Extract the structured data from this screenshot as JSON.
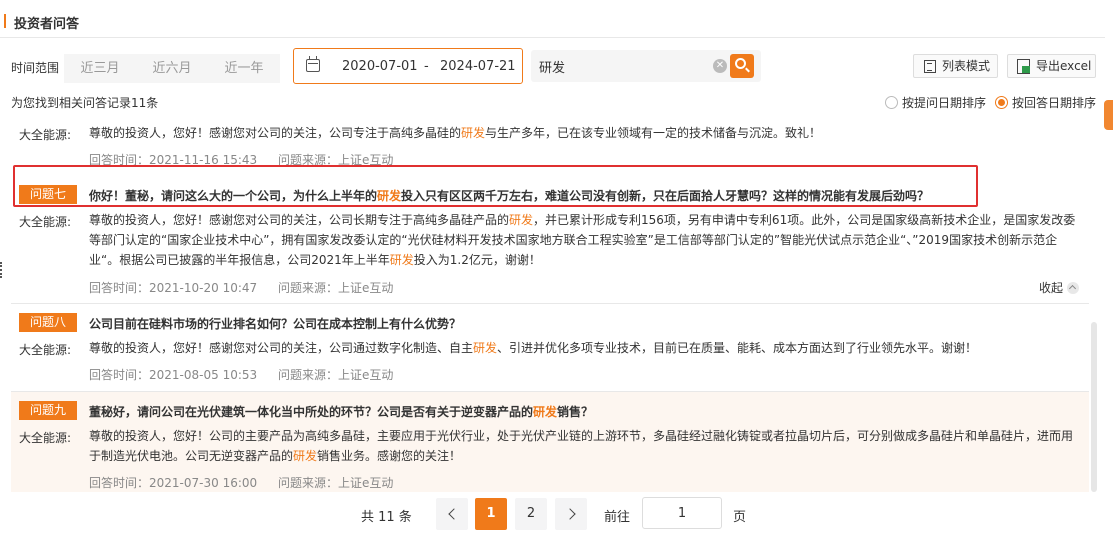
{
  "header": {
    "title": "投资者问答"
  },
  "filter": {
    "range_label": "时间范围",
    "range_options": [
      "近三月",
      "近六月",
      "近一年"
    ],
    "date_start": "2020-07-01",
    "date_sep": "-",
    "date_end": "2024-07-21",
    "search_value": "研发",
    "list_mode_label": "列表模式",
    "export_label": "导出excel"
  },
  "results": {
    "found_text": "为您找到相关问答记录11条",
    "sort_by_ask_date": "按提问日期排序",
    "sort_by_answer_date": "按回答日期排序",
    "selected_sort": "按回答日期排序"
  },
  "answer_label": "大全能源:",
  "answer_time_prefix": "回答时间：",
  "source_prefix": "问题来源：",
  "items": [
    {
      "answer_parts": [
        "尊敬的投资人，您好！感谢您对公司的关注，公司专注于高纯多晶硅的",
        "研发",
        "与生产多年，已在该专业领域有一定的技术储备与沉淀。致礼！"
      ],
      "answer_time": "2021-11-16 15:43",
      "source": "上证e互动"
    },
    {
      "tag": "问题七",
      "question_parts": [
        "你好！董秘，请问这么大的一个公司，为什么上半年的",
        "研发",
        "投入只有区区两千万左右，难道公司没有创新，只在后面拾人牙慧吗？这样的情况能有发展后劲吗？"
      ],
      "answer_parts": [
        "尊敬的投资人，您好！感谢您对公司的关注，公司长期专注于高纯多晶硅产品的",
        "研发",
        "，并已累计形成专利156项，另有申请中专利61项。此外，公司是国家级高新技术企业，是国家发改委等部门认定的“国家企业技术中心”，拥有国家发改委认定的“光伏硅材料开发技术国家地方联合工程实验室”是工信部等部门认定的”智能光伏试点示范企业“、”2019国家技术创新示范企业“。根据公司已披露的半年报信息，公司2021年上半年",
        "研发",
        "投入为1.2亿元，谢谢！"
      ],
      "answer_time": "2021-10-20 10:47",
      "source": "上证e互动",
      "collapse_label": "收起"
    },
    {
      "tag": "问题八",
      "question_parts": [
        "公司目前在硅料市场的行业排名如何？公司在成本控制上有什么优势？"
      ],
      "answer_parts": [
        "尊敬的投资人，您好！感谢您对公司的关注，公司通过数字化制造、自主",
        "研发",
        "、引进并优化多项专业技术，目前已在质量、能耗、成本方面达到了行业领先水平。谢谢！"
      ],
      "answer_time": "2021-08-05 10:53",
      "source": "上证e互动"
    },
    {
      "tag": "问题九",
      "question_parts": [
        "董秘好，请问公司在光伏建筑一体化当中所处的环节？公司是否有关于逆变器产品的",
        "研发",
        "销售？"
      ],
      "answer_parts": [
        "尊敬的投资人，您好！公司的主要产品为高纯多晶硅，主要应用于光伏行业，处于光伏产业链的上游环节，多晶硅经过融化铸锭或者拉晶切片后，可分别做成多晶硅片和单晶硅片，进而用于制造光伏电池。公司无逆变器产品的",
        "研发",
        "销售业务。感谢您的关注！"
      ],
      "answer_time": "2021-07-30 16:00",
      "source": "上证e互动"
    }
  ],
  "pagination": {
    "total_text": "共 11 条",
    "pages": [
      "1",
      "2"
    ],
    "current_page": "1",
    "goto_label": "前往",
    "goto_value": "1",
    "page_unit": "页"
  },
  "colors": {
    "accent": "#f07a1a",
    "highlight_border": "#e03030",
    "hover_row": "#fdf6f0"
  }
}
